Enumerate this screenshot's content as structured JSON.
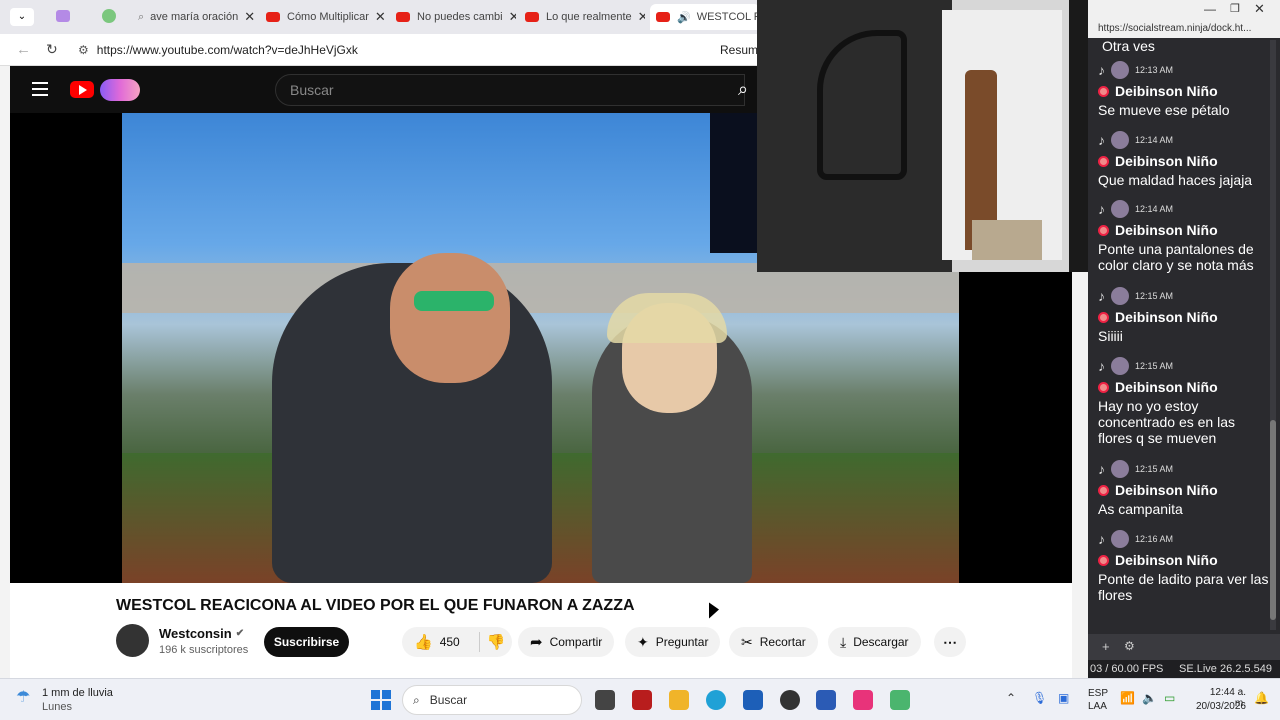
{
  "browser": {
    "tabs": [
      {
        "label": "ave maría oración"
      },
      {
        "label": "Cómo Multiplicar"
      },
      {
        "label": "No puedes cambi"
      },
      {
        "label": "Lo que realmente"
      },
      {
        "label": "WESTCOL RE"
      }
    ],
    "url": "https://www.youtube.com/watch?v=deJhHeVjGxk",
    "resume_label": "Resumi"
  },
  "youtube": {
    "search_placeholder": "Buscar",
    "video_title": "WESTCOL REACICONA AL VIDEO POR EL QUE FUNARON A ZAZZA",
    "channel_name": "Westconsin",
    "subscribers": "196 k suscriptores",
    "subscribe_label": "Suscribirse",
    "like_count": "450",
    "share_label": "Compartir",
    "ask_label": "Preguntar",
    "clip_label": "Recortar",
    "download_label": "Descargar"
  },
  "chat": {
    "url": "https://socialstream.ninja/dock.ht...",
    "top_text": "Otra ves",
    "messages": [
      {
        "time": "12:13 AM",
        "user": "Deibinson Niño",
        "text": "Se mueve ese pétalo"
      },
      {
        "time": "12:14 AM",
        "user": "Deibinson Niño",
        "text": "Que maldad haces jajaja"
      },
      {
        "time": "12:14 AM",
        "user": "Deibinson Niño",
        "text": "Ponte una pantalones de color claro y se nota más"
      },
      {
        "time": "12:15 AM",
        "user": "Deibinson Niño",
        "text": "Siiiii"
      },
      {
        "time": "12:15 AM",
        "user": "Deibinson Niño",
        "text": "Hay no yo estoy concentrado es en las flores q se mueven"
      },
      {
        "time": "12:15 AM",
        "user": "Deibinson Niño",
        "text": "As campanita"
      },
      {
        "time": "12:16 AM",
        "user": "Deibinson Niño",
        "text": "Ponte de ladito para ver las flores"
      }
    ],
    "fps": "03 / 60.00 FPS",
    "version": "SE.Live 26.2.5.549"
  },
  "taskbar": {
    "weather_title": "1 mm de lluvia",
    "weather_sub": "Lunes",
    "search_placeholder": "Buscar",
    "lang_top": "ESP",
    "lang_bottom": "LAA",
    "time": "12:44 a. m.",
    "date": "20/03/2026"
  }
}
